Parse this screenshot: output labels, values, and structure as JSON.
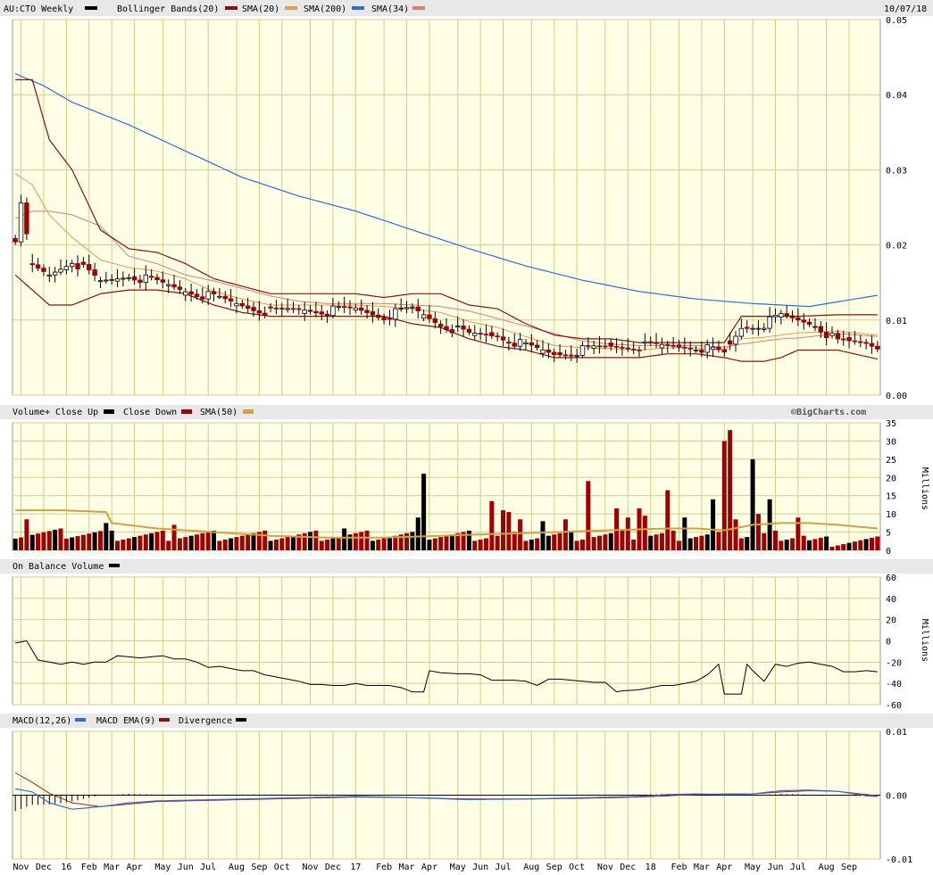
{
  "colors": {
    "background": "#ffffff",
    "panel_bg": "#ffffe6",
    "grid": "#cfcf8f",
    "header_bg": "#e8e8e8",
    "up": "#000000",
    "down": "#a00000",
    "bollinger": "#8b1010",
    "sma20": "#e89a4a",
    "sma200": "#2b6fd6",
    "sma34": "#e07a7a",
    "volume_sma": "#d4a040",
    "obv": "#000000",
    "macd": "#2b6fd6",
    "macd_ema": "#a52020",
    "divergence": "#000000"
  },
  "header": {
    "ticker": "AU:CTO Weekly",
    "date": "10/07/18",
    "watermark": "©BigCharts.com"
  },
  "x_axis": {
    "labels": [
      "Nov",
      "Dec",
      "16",
      "Feb",
      "Mar",
      "Apr",
      "May",
      "Jun",
      "Jul",
      "Aug",
      "Sep",
      "Oct",
      "Nov",
      "Dec",
      "17",
      "Feb",
      "Mar",
      "Apr",
      "May",
      "Jun",
      "Jul",
      "Aug",
      "Sep",
      "Oct",
      "Nov",
      "Dec",
      "18",
      "Feb",
      "Mar",
      "Apr",
      "May",
      "Jun",
      "Jul",
      "Aug",
      "Sep"
    ],
    "label_weeks": [
      1,
      5,
      9,
      13,
      17,
      21,
      26,
      30,
      34,
      39,
      43,
      47,
      52,
      56,
      60,
      65,
      69,
      73,
      78,
      82,
      86,
      91,
      95,
      99,
      104,
      108,
      112,
      117,
      121,
      125,
      130,
      134,
      138,
      143,
      147
    ],
    "week_count": 153
  },
  "chart_data": [
    {
      "type": "candlestick",
      "title": "AU:CTO Weekly",
      "legend": [
        {
          "label": "Bollinger Bands(20)",
          "color_key": "bollinger"
        },
        {
          "label": "SMA(20)",
          "color_key": "sma20"
        },
        {
          "label": "SMA(200)",
          "color_key": "sma200"
        },
        {
          "label": "SMA(34)",
          "color_key": "sma34"
        }
      ],
      "ylim": [
        0,
        0.05
      ],
      "y_ticks": [
        "0.05",
        "0.04",
        "0.03",
        "0.02",
        "0.01",
        "0.00"
      ],
      "y_tick_values": [
        0.05,
        0.04,
        0.03,
        0.02,
        0.01,
        0
      ],
      "close_anchors": {
        "weeks": [
          0,
          1,
          3,
          6,
          10,
          15,
          20,
          25,
          30,
          35,
          40,
          45,
          50,
          55,
          60,
          65,
          70,
          75,
          80,
          85,
          90,
          95,
          100,
          105,
          110,
          115,
          120,
          125,
          128,
          132,
          135,
          138,
          141,
          145,
          150,
          152
        ],
        "values": [
          0.021,
          0.025,
          0.017,
          0.016,
          0.018,
          0.015,
          0.016,
          0.015,
          0.014,
          0.013,
          0.012,
          0.011,
          0.0115,
          0.0112,
          0.0115,
          0.0105,
          0.0115,
          0.0095,
          0.008,
          0.008,
          0.0065,
          0.0055,
          0.006,
          0.0065,
          0.0065,
          0.0065,
          0.0065,
          0.0055,
          0.009,
          0.0095,
          0.0105,
          0.01,
          0.0095,
          0.007,
          0.007,
          0.0065
        ]
      },
      "bollinger_upper": {
        "weeks": [
          0,
          3,
          6,
          10,
          15,
          20,
          25,
          30,
          35,
          40,
          45,
          50,
          55,
          60,
          65,
          70,
          75,
          80,
          85,
          90,
          95,
          100,
          105,
          110,
          115,
          120,
          125,
          128,
          132,
          135,
          138,
          145,
          152
        ],
        "values": [
          0.042,
          0.042,
          0.034,
          0.03,
          0.022,
          0.0195,
          0.019,
          0.0175,
          0.0155,
          0.0145,
          0.0135,
          0.0135,
          0.0135,
          0.0135,
          0.013,
          0.0135,
          0.0135,
          0.012,
          0.0115,
          0.0095,
          0.008,
          0.0075,
          0.0075,
          0.007,
          0.007,
          0.007,
          0.007,
          0.0105,
          0.0105,
          0.0105,
          0.0105,
          0.0107,
          0.0107
        ]
      },
      "bollinger_lower": {
        "weeks": [
          0,
          3,
          6,
          10,
          15,
          20,
          25,
          30,
          35,
          40,
          45,
          50,
          55,
          60,
          65,
          70,
          75,
          80,
          85,
          90,
          95,
          100,
          105,
          110,
          115,
          120,
          125,
          128,
          132,
          135,
          138,
          145,
          152
        ],
        "values": [
          0.016,
          0.014,
          0.012,
          0.012,
          0.0135,
          0.014,
          0.014,
          0.0135,
          0.012,
          0.011,
          0.0105,
          0.0105,
          0.0105,
          0.0105,
          0.0105,
          0.0095,
          0.009,
          0.0075,
          0.0065,
          0.006,
          0.005,
          0.005,
          0.005,
          0.005,
          0.0055,
          0.0055,
          0.005,
          0.0045,
          0.0045,
          0.005,
          0.006,
          0.006,
          0.0048
        ]
      },
      "sma20": {
        "weeks": [
          0,
          3,
          6,
          10,
          15,
          20,
          25,
          30,
          35,
          40,
          45,
          50,
          55,
          60,
          65,
          70,
          75,
          80,
          85,
          90,
          95,
          100,
          105,
          110,
          115,
          120,
          125,
          128,
          132,
          135,
          138,
          145,
          152
        ],
        "values": [
          0.0295,
          0.028,
          0.024,
          0.021,
          0.018,
          0.017,
          0.0165,
          0.0155,
          0.0138,
          0.0128,
          0.012,
          0.012,
          0.012,
          0.012,
          0.0118,
          0.0115,
          0.011,
          0.0098,
          0.009,
          0.0078,
          0.0066,
          0.0063,
          0.0062,
          0.006,
          0.0063,
          0.0063,
          0.006,
          0.0075,
          0.0077,
          0.008,
          0.0083,
          0.0085,
          0.008
        ]
      },
      "sma34": {
        "weeks": [
          0,
          3,
          6,
          10,
          15,
          20,
          25,
          30,
          35,
          40,
          45,
          50,
          55,
          60,
          65,
          70,
          75,
          80,
          85,
          90,
          95,
          100,
          105,
          110,
          115,
          120,
          125,
          128,
          132,
          135,
          138,
          145,
          152
        ],
        "values": [
          0.0235,
          0.0245,
          0.0245,
          0.024,
          0.0225,
          0.0185,
          0.0175,
          0.016,
          0.0152,
          0.0142,
          0.0132,
          0.0125,
          0.0122,
          0.0122,
          0.0122,
          0.012,
          0.0118,
          0.0112,
          0.0102,
          0.0092,
          0.0082,
          0.0072,
          0.0068,
          0.0066,
          0.0066,
          0.0066,
          0.0064,
          0.0068,
          0.0072,
          0.0075,
          0.0076,
          0.0082,
          0.0078
        ]
      },
      "sma200": {
        "weeks": [
          0,
          5,
          10,
          20,
          30,
          40,
          50,
          60,
          70,
          80,
          90,
          100,
          110,
          120,
          125,
          130,
          140,
          152
        ],
        "values": [
          0.0428,
          0.0412,
          0.039,
          0.036,
          0.0325,
          0.029,
          0.0265,
          0.0245,
          0.022,
          0.0195,
          0.0172,
          0.0153,
          0.0138,
          0.0128,
          0.0125,
          0.0122,
          0.0118,
          0.0133
        ]
      }
    },
    {
      "type": "bar",
      "title": "Volume+",
      "legend": [
        {
          "label": "Volume+",
          "color_key": ""
        },
        {
          "label": "Close Up",
          "color_key": "up"
        },
        {
          "label": "Close Down",
          "color_key": "down"
        },
        {
          "label": "SMA(50)",
          "color_key": "volume_sma"
        }
      ],
      "ylabel": "Millions",
      "ylim": [
        0,
        35
      ],
      "y_ticks": [
        "35",
        "30",
        "25",
        "20",
        "15",
        "10",
        "5",
        "0"
      ],
      "y_tick_values": [
        35,
        30,
        25,
        20,
        15,
        10,
        5,
        0
      ],
      "spikes": [
        {
          "week": 2,
          "value": 8.5,
          "up": false
        },
        {
          "week": 16,
          "value": 7.5,
          "up": true
        },
        {
          "week": 28,
          "value": 7.0,
          "up": false
        },
        {
          "week": 58,
          "value": 6.0,
          "up": true
        },
        {
          "week": 71,
          "value": 9.0,
          "up": true
        },
        {
          "week": 72,
          "value": 21.0,
          "up": true
        },
        {
          "week": 84,
          "value": 13.5,
          "up": false
        },
        {
          "week": 86,
          "value": 11.0,
          "up": false
        },
        {
          "week": 87,
          "value": 10.5,
          "up": false
        },
        {
          "week": 89,
          "value": 8.5,
          "up": false
        },
        {
          "week": 93,
          "value": 8.0,
          "up": true
        },
        {
          "week": 97,
          "value": 8.5,
          "up": false
        },
        {
          "week": 101,
          "value": 19.0,
          "up": false
        },
        {
          "week": 106,
          "value": 11.5,
          "up": false
        },
        {
          "week": 108,
          "value": 9.0,
          "up": false
        },
        {
          "week": 110,
          "value": 11.5,
          "up": false
        },
        {
          "week": 111,
          "value": 9.5,
          "up": false
        },
        {
          "week": 115,
          "value": 16.5,
          "up": false
        },
        {
          "week": 118,
          "value": 9.0,
          "up": true
        },
        {
          "week": 123,
          "value": 14.0,
          "up": true
        },
        {
          "week": 125,
          "value": 30.0,
          "up": false
        },
        {
          "week": 126,
          "value": 33.0,
          "up": false
        },
        {
          "week": 127,
          "value": 8.5,
          "up": false
        },
        {
          "week": 130,
          "value": 25.0,
          "up": true
        },
        {
          "week": 131,
          "value": 10.0,
          "up": false
        },
        {
          "week": 133,
          "value": 14.0,
          "up": true
        },
        {
          "week": 138,
          "value": 9.0,
          "up": false
        }
      ],
      "sma50": {
        "weeks": [
          0,
          8,
          16,
          17,
          25,
          35,
          45,
          55,
          65,
          75,
          85,
          95,
          105,
          115,
          120,
          125,
          130,
          135,
          140,
          145,
          152
        ],
        "values": [
          11.0,
          11.0,
          10.5,
          7.5,
          6.0,
          5.0,
          4.0,
          3.5,
          3.5,
          4.0,
          4.5,
          5.0,
          5.5,
          6.0,
          6.0,
          5.5,
          7.0,
          7.5,
          7.5,
          7.0,
          6.0
        ]
      }
    },
    {
      "type": "line",
      "title": "On Balance Volume",
      "legend": [
        {
          "label": "On Balance Volume",
          "color_key": "obv"
        }
      ],
      "ylabel": "Millions",
      "ylim": [
        -60,
        60
      ],
      "y_ticks": [
        "60",
        "40",
        "20",
        "0",
        "-20",
        "-40",
        "-60"
      ],
      "y_tick_values": [
        60,
        40,
        20,
        0,
        -20,
        -40,
        -60
      ],
      "weeks": [
        0,
        2,
        4,
        6,
        8,
        10,
        12,
        14,
        16,
        18,
        20,
        22,
        24,
        26,
        28,
        30,
        32,
        34,
        36,
        38,
        40,
        42,
        44,
        46,
        48,
        50,
        52,
        54,
        56,
        58,
        60,
        62,
        64,
        66,
        68,
        70,
        72,
        73,
        75,
        78,
        80,
        82,
        84,
        86,
        88,
        90,
        92,
        94,
        96,
        98,
        100,
        102,
        104,
        106,
        107,
        110,
        112,
        114,
        116,
        118,
        120,
        122,
        124,
        125,
        126,
        128,
        129,
        130,
        132,
        134,
        136,
        138,
        140,
        142,
        144,
        146,
        148,
        150,
        152
      ],
      "values": [
        -2,
        0,
        -18,
        -20,
        -22,
        -20,
        -22,
        -20,
        -20,
        -14,
        -15,
        -16,
        -15,
        -14,
        -17,
        -17,
        -20,
        -25,
        -24,
        -26,
        -28,
        -28,
        -32,
        -34,
        -36,
        -38,
        -41,
        -41,
        -42,
        -42,
        -40,
        -42,
        -42,
        -42,
        -44,
        -48,
        -48,
        -28,
        -30,
        -31,
        -31,
        -32,
        -37,
        -37,
        -37,
        -38,
        -42,
        -36,
        -36,
        -37,
        -38,
        -39,
        -39,
        -48,
        -47,
        -46,
        -44,
        -42,
        -42,
        -40,
        -38,
        -32,
        -22,
        -50,
        -50,
        -50,
        -22,
        -28,
        -38,
        -22,
        -24,
        -21,
        -20,
        -22,
        -24,
        -29,
        -29,
        -28,
        -29
      ]
    },
    {
      "type": "line",
      "title": "MACD",
      "legend": [
        {
          "label": "MACD(12,26)",
          "color_key": "macd"
        },
        {
          "label": "MACD EMA(9)",
          "color_key": "macd_ema"
        },
        {
          "label": "Divergence",
          "color_key": "divergence"
        }
      ],
      "ylim": [
        -0.01,
        0.01
      ],
      "y_ticks": [
        "0.01",
        "0.00",
        "-0.01"
      ],
      "y_tick_values": [
        0.01,
        0,
        -0.01
      ],
      "macd": {
        "weeks": [
          0,
          3,
          6,
          10,
          15,
          20,
          25,
          30,
          40,
          50,
          60,
          70,
          80,
          90,
          100,
          110,
          115,
          120,
          125,
          130,
          135,
          140,
          145,
          150,
          152
        ],
        "values": [
          0.001,
          0.0005,
          -0.0012,
          -0.0022,
          -0.0018,
          -0.0012,
          -0.0009,
          -0.0008,
          -0.0006,
          -0.0004,
          -0.0002,
          -0.0004,
          -0.0007,
          -0.0006,
          -0.0004,
          -0.0002,
          0.0001,
          0.0002,
          0.0001,
          0.0002,
          0.0007,
          0.0008,
          0.0006,
          -0.0001,
          -0.0002
        ]
      },
      "macd_ema": {
        "weeks": [
          0,
          3,
          6,
          10,
          15,
          20,
          25,
          30,
          40,
          50,
          60,
          70,
          80,
          90,
          100,
          110,
          115,
          120,
          125,
          130,
          135,
          140,
          145,
          150,
          152
        ],
        "values": [
          0.0035,
          0.002,
          0.0003,
          -0.0012,
          -0.0018,
          -0.0014,
          -0.001,
          -0.0009,
          -0.0007,
          -0.0005,
          -0.0003,
          -0.0004,
          -0.0006,
          -0.0006,
          -0.0005,
          -0.0003,
          -0.0001,
          0.0001,
          0.0002,
          0.0002,
          0.0005,
          0.0007,
          0.0006,
          0.0001,
          -0.0001
        ]
      }
    }
  ]
}
